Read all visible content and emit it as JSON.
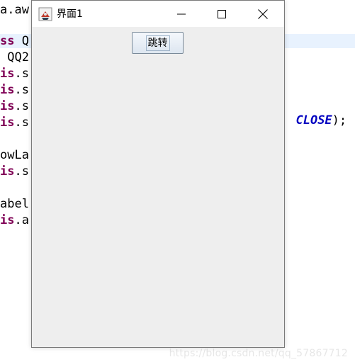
{
  "editor": {
    "lines": [
      {
        "segments": [
          {
            "text": "a.aw",
            "style": "normal"
          }
        ]
      },
      {
        "segments": [
          {
            "text": "ss",
            "style": "kw"
          },
          {
            "text": " Q",
            "style": "normal"
          }
        ],
        "highlighted": true
      },
      {
        "segments": [
          {
            "text": " QQ2",
            "style": "normal"
          }
        ]
      },
      {
        "segments": [
          {
            "text": "is",
            "style": "kw"
          },
          {
            "text": ".s",
            "style": "normal"
          }
        ]
      },
      {
        "segments": [
          {
            "text": "is",
            "style": "kw"
          },
          {
            "text": ".s",
            "style": "normal"
          }
        ]
      },
      {
        "segments": [
          {
            "text": "is",
            "style": "kw"
          },
          {
            "text": ".s",
            "style": "normal"
          }
        ]
      },
      {
        "segments": [
          {
            "text": "is",
            "style": "kw"
          },
          {
            "text": ".s",
            "style": "normal"
          }
        ]
      },
      {
        "segments": []
      },
      {
        "segments": [
          {
            "text": "owLa",
            "style": "normal"
          }
        ]
      },
      {
        "segments": [
          {
            "text": "is",
            "style": "kw"
          },
          {
            "text": ".s",
            "style": "normal"
          }
        ]
      },
      {
        "segments": []
      },
      {
        "segments": [
          {
            "text": "abel",
            "style": "normal"
          }
        ]
      },
      {
        "segments": [
          {
            "text": "is",
            "style": "kw"
          },
          {
            "text": ".a",
            "style": "normal"
          }
        ]
      }
    ],
    "right_fragment": {
      "constant": "CLOSE",
      "suffix": ");"
    }
  },
  "window": {
    "title": "界面1",
    "icon": "java-cup-icon",
    "controls": {
      "minimize_icon": "minimize-icon",
      "maximize_icon": "maximize-icon",
      "close_icon": "close-icon"
    },
    "button_label": "跳转"
  },
  "watermark": "https://blog.csdn.net/qq_57867712"
}
